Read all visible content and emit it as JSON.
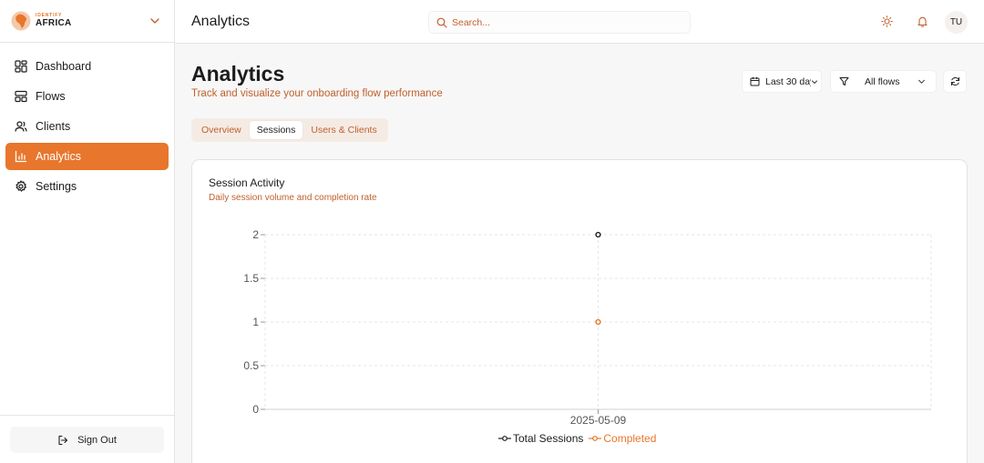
{
  "brand": {
    "small": "IDENTIFY",
    "big": "AFRICA"
  },
  "sidebar": {
    "items": [
      {
        "label": "Dashboard"
      },
      {
        "label": "Flows"
      },
      {
        "label": "Clients"
      },
      {
        "label": "Analytics"
      },
      {
        "label": "Settings"
      }
    ],
    "active": "Analytics",
    "sign_out": "Sign Out"
  },
  "topbar": {
    "title": "Analytics",
    "search_placeholder": "Search...",
    "avatar_initials": "TU"
  },
  "page": {
    "title": "Analytics",
    "subtitle": "Track and visualize your onboarding flow performance"
  },
  "filters": {
    "date_range": "Last 30 days",
    "flow": "All flows"
  },
  "tabs": [
    {
      "label": "Overview",
      "active": false
    },
    {
      "label": "Sessions",
      "active": true
    },
    {
      "label": "Users & Clients",
      "active": false
    }
  ],
  "card": {
    "title": "Session Activity",
    "subtitle": "Daily session volume and completion rate"
  },
  "colors": {
    "accent": "#e8762c",
    "accent_text": "#c0612c",
    "series_total": "#1c1c1c",
    "series_completed": "#e8762c"
  },
  "chart_data": {
    "type": "line",
    "x": [
      "2025-05-09"
    ],
    "series": [
      {
        "name": "Total Sessions",
        "values": [
          2
        ],
        "color": "#1c1c1c"
      },
      {
        "name": "Completed",
        "values": [
          1
        ],
        "color": "#e8762c"
      }
    ],
    "yticks": [
      "0",
      "0.5",
      "1",
      "1.5",
      "2"
    ],
    "ylim": [
      0,
      2
    ],
    "grid": true,
    "legend": "bottom-center"
  }
}
